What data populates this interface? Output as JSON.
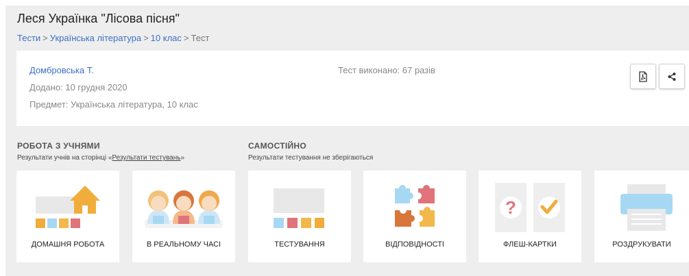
{
  "title": "Леся Українка \"Лісова пісня\"",
  "breadcrumbs": {
    "items": [
      "Тести",
      "Українська література",
      "10 клас"
    ],
    "current": "Тест",
    "separator": ">"
  },
  "info": {
    "author": "Домбровська Т.",
    "added": "Додано: 10 грудня 2020",
    "subject": "Предмет: Українська література, 10 клас",
    "runs": "Тест виконано: 67 разів",
    "pdf_icon": "pdf-icon",
    "share_icon": "share-icon"
  },
  "sections": {
    "work": {
      "heading": "РОБОТА З УЧНЯМИ",
      "sub_prefix": "Результати учнів на сторінці «",
      "sub_link": "Результати тестувань",
      "sub_suffix": "»"
    },
    "self": {
      "heading": "САМОСТІЙНО",
      "sub": "Результати тестування не зберігаються"
    }
  },
  "cards": [
    {
      "label": "ДОМАШНЯ РОБОТА",
      "icon": "house-icon"
    },
    {
      "label": "В РЕАЛЬНОМУ ЧАСІ",
      "icon": "students-icon"
    },
    {
      "label": "ТЕСТУВАННЯ",
      "icon": "test-icon"
    },
    {
      "label": "ВІДПОВІДНОСТІ",
      "icon": "puzzle-icon"
    },
    {
      "label": "ФЛЕШ-КАРТКИ",
      "icon": "flashcards-icon"
    },
    {
      "label": "РОЗДРУКУВАТИ",
      "icon": "printer-icon"
    }
  ],
  "colors": {
    "link": "#3b6fc4",
    "background": "#eeeeee",
    "card": "#ffffff",
    "orange": "#f0ad3c",
    "blue": "#a7d8f3",
    "red": "#e0747a",
    "yellow": "#f2b84b",
    "gray": "#e8e8e8"
  }
}
